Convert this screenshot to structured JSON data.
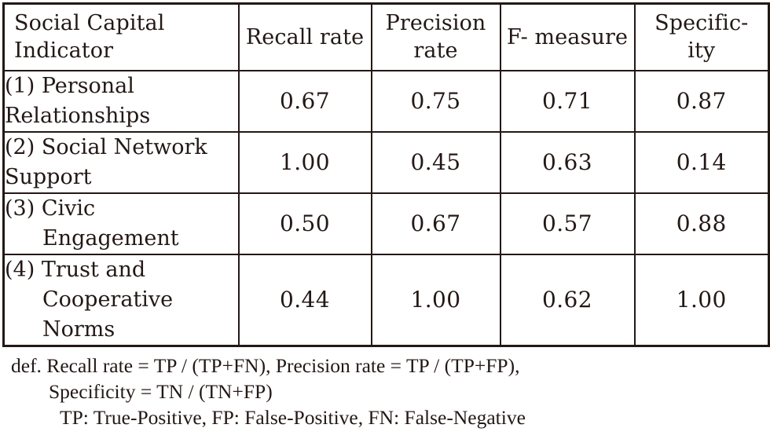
{
  "table": {
    "columns": [
      {
        "id": "indicator",
        "label_lines": [
          "Social Capital",
          "Indicator"
        ],
        "align": "left"
      },
      {
        "id": "recall",
        "label_lines": [
          "Recall",
          "rate"
        ],
        "align": "center"
      },
      {
        "id": "precision",
        "label_lines": [
          "Precision",
          "rate"
        ],
        "align": "center"
      },
      {
        "id": "fmeasure",
        "label_lines": [
          "F-",
          "measure"
        ],
        "align": "center"
      },
      {
        "id": "specificity",
        "label_lines": [
          "Specific-",
          "ity"
        ],
        "align": "center"
      }
    ],
    "rows": [
      {
        "indicator_lines": [
          "(1) Personal",
          "Relationships"
        ],
        "indicator_indent": [
          false,
          false
        ],
        "recall": "0.67",
        "precision": "0.75",
        "fmeasure": "0.71",
        "specificity": "0.87"
      },
      {
        "indicator_lines": [
          "(2) Social Network",
          "Support"
        ],
        "indicator_indent": [
          false,
          false
        ],
        "recall": "1.00",
        "precision": "0.45",
        "fmeasure": "0.63",
        "specificity": "0.14"
      },
      {
        "indicator_lines": [
          "(3) Civic",
          "Engagement"
        ],
        "indicator_indent": [
          false,
          true
        ],
        "recall": "0.50",
        "precision": "0.67",
        "fmeasure": "0.57",
        "specificity": "0.88"
      },
      {
        "indicator_lines": [
          "(4) Trust and",
          "Cooperative",
          "Norms"
        ],
        "indicator_indent": [
          false,
          true,
          true
        ],
        "recall": "0.44",
        "precision": "1.00",
        "fmeasure": "0.62",
        "specificity": "1.00"
      }
    ]
  },
  "footnote": {
    "line1": "def. Recall rate = TP / (TP+FN), Precision rate = TP / (TP+FP),",
    "line2": "Specificity = TN / (TN+FP)",
    "line3": "TP: True-Positive, FP: False-Positive, FN: False-Negative"
  },
  "colors": {
    "ink": "#231815",
    "background": "#ffffff"
  }
}
